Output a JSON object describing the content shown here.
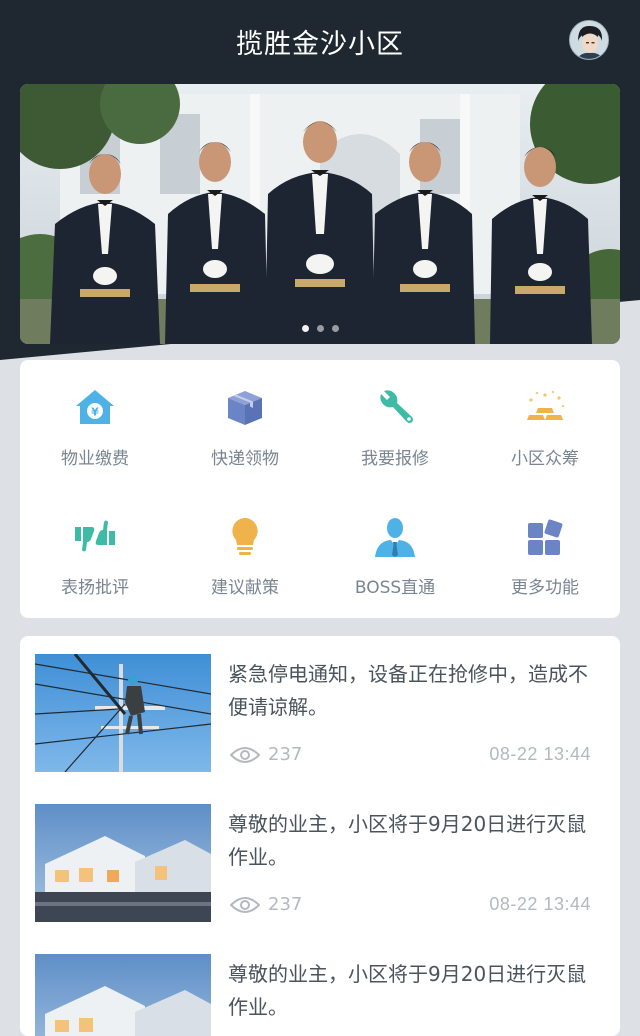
{
  "header": {
    "title": "揽胜金沙小区"
  },
  "banner": {
    "page_count": 3,
    "active_index": 0
  },
  "services": [
    {
      "label": "物业缴费",
      "icon": "house-yen-icon",
      "color": "#4fb2e6"
    },
    {
      "label": "快递领物",
      "icon": "package-icon",
      "color": "#6b84c6"
    },
    {
      "label": "我要报修",
      "icon": "wrench-icon",
      "color": "#3dbba5"
    },
    {
      "label": "小区众筹",
      "icon": "gold-bars-icon",
      "color": "#f0b24a"
    },
    {
      "label": "表扬批评",
      "icon": "thumbs-icon",
      "color": "#3dbba5"
    },
    {
      "label": "建议献策",
      "icon": "lightbulb-icon",
      "color": "#f0b24a"
    },
    {
      "label": "BOSS直通",
      "icon": "boss-icon",
      "color": "#4fb2e6"
    },
    {
      "label": "更多功能",
      "icon": "more-grid-icon",
      "color": "#6b84c6"
    }
  ],
  "news": [
    {
      "title": "紧急停电通知，设备正在抢修中，造成不便请谅解。",
      "views": "237",
      "date": "08-22 13:44",
      "thumb": "power-line-worker"
    },
    {
      "title": "尊敬的业主，小区将于9月20日进行灭鼠作业。",
      "views": "237",
      "date": "08-22 13:44",
      "thumb": "house-exterior"
    },
    {
      "title": "尊敬的业主，小区将于9月20日进行灭鼠作业。",
      "views": "",
      "date": "",
      "thumb": "house-exterior"
    }
  ]
}
